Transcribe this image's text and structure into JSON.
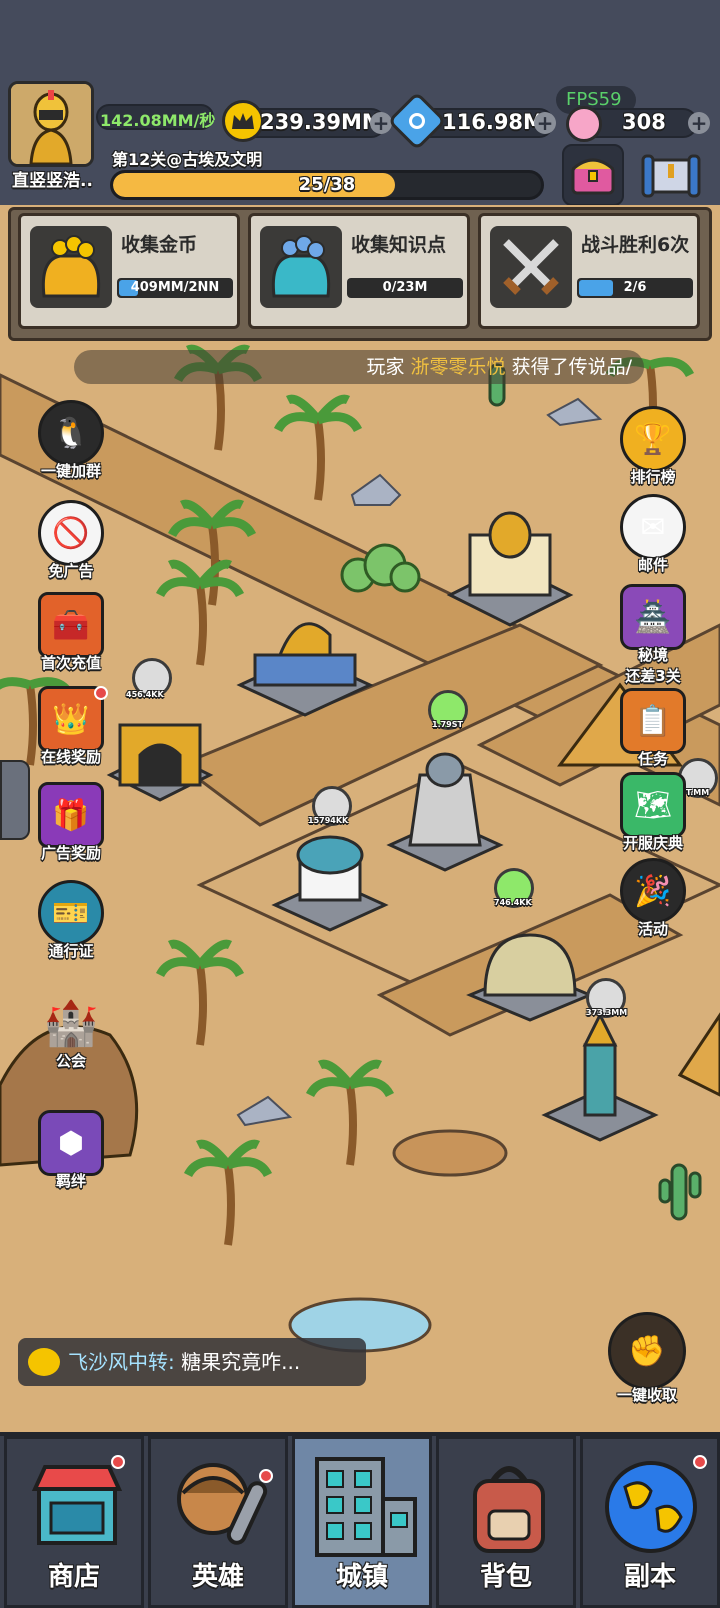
{
  "status": {
    "fps": "FPS59"
  },
  "player": {
    "name": "直竖竖浩..",
    "income": "142.08MM/秒",
    "stage": "第12关@古埃及文明",
    "progress_text": "25/38",
    "progress_value": 0.658
  },
  "currencies": {
    "gold": "239.39MM",
    "knowledge": "116.98M",
    "gems": "308"
  },
  "quests": [
    {
      "title": "收集金币",
      "progress": "409MM/2NN",
      "value": 0.2,
      "icon": "gold-bag-icon"
    },
    {
      "title": "收集知识点",
      "progress": "0/23M",
      "value": 0.0,
      "icon": "knowledge-bag-icon"
    },
    {
      "title": "战斗胜利6次",
      "progress": "2/6",
      "value": 0.33,
      "icon": "crossed-swords-icon"
    }
  ],
  "marquee": {
    "prefix": "玩家",
    "player": "浙零零乐悦",
    "suffix": "获得了传说品/"
  },
  "left_buttons": [
    {
      "label": "一键加群",
      "icon": "penguin-icon"
    },
    {
      "label": "免广告",
      "icon": "no-ads-icon"
    },
    {
      "label": "首次充值",
      "icon": "treasure-chest-icon"
    },
    {
      "label": "在线奖励",
      "icon": "crown-chest-icon"
    },
    {
      "label": "广告奖励",
      "icon": "purple-chest-icon"
    },
    {
      "label": "通行证",
      "icon": "pass-icon"
    },
    {
      "label": "公会",
      "icon": "castle-icon"
    },
    {
      "label": "羁绊",
      "icon": "bond-icon"
    }
  ],
  "right_buttons": [
    {
      "label": "排行榜",
      "icon": "trophy-icon"
    },
    {
      "label": "邮件",
      "icon": "mail-icon"
    },
    {
      "label": "秘境",
      "sublabel": "还差3关",
      "icon": "portal-icon"
    },
    {
      "label": "任务",
      "icon": "clipboard-icon"
    },
    {
      "label": "开服庆典",
      "icon": "celebration-icon"
    },
    {
      "label": "活动",
      "icon": "party-icon"
    },
    {
      "label": "一键收取",
      "icon": "collect-all-icon"
    }
  ],
  "map_tags": [
    "456.4KK",
    "1.79ST",
    "15794KK",
    "746.4KK",
    "373.3MM",
    "T.MM"
  ],
  "chat": {
    "who": "飞沙风中转:",
    "text": "糖果究竟咋..."
  },
  "nav": [
    {
      "label": "商店",
      "icon": "shop-icon",
      "badge": true
    },
    {
      "label": "英雄",
      "icon": "caveman-icon",
      "badge": true
    },
    {
      "label": "城镇",
      "icon": "building-icon",
      "badge": false,
      "active": true
    },
    {
      "label": "背包",
      "icon": "backpack-icon",
      "badge": false
    },
    {
      "label": "副本",
      "icon": "globe-icon",
      "badge": true
    }
  ],
  "colors": {
    "topbar": "#454b5c",
    "sand": "#d8b07a",
    "road": "#c99a5d",
    "progress": "#f5b942",
    "accent_blue": "#4aa3e8",
    "nav_active": "#6f87a6"
  }
}
